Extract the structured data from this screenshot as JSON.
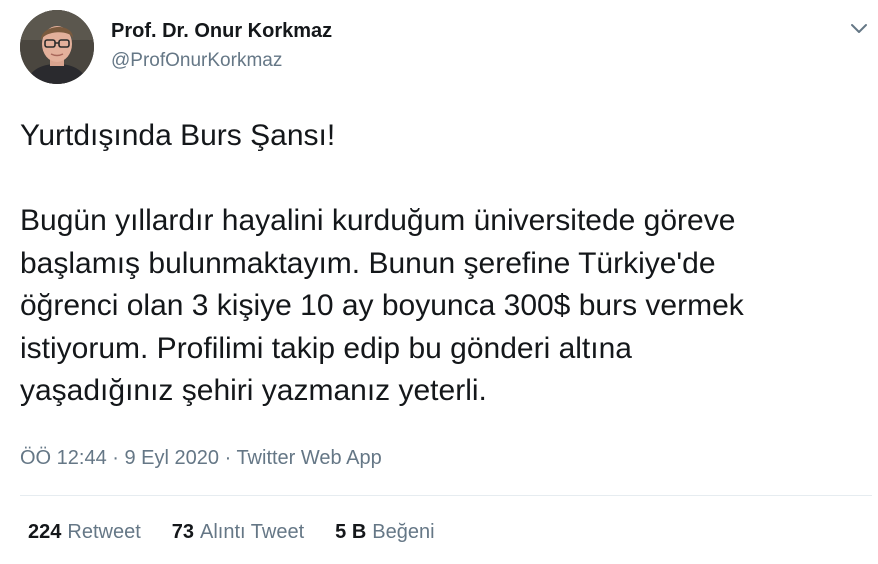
{
  "author": {
    "name": "Prof. Dr. Onur Korkmaz",
    "handle": "@ProfOnurKorkmaz"
  },
  "tweet": {
    "lines": [
      "Yurtdışında Burs Şansı!",
      "",
      "Bugün yıllardır hayalini kurduğum üniversitede göreve",
      "başlamış bulunmaktayım. Bunun şerefine Türkiye'de",
      "öğrenci olan 3 kişiye 10 ay boyunca 300$ burs vermek",
      "istiyorum. Profilimi takip edip bu gönderi altına",
      "yaşadığınız şehiri yazmanız yeterli."
    ]
  },
  "meta": {
    "time": "ÖÖ 12:44",
    "separator": " · ",
    "date": "9 Eyl 2020",
    "source": "Twitter Web App"
  },
  "stats": {
    "retweets": {
      "count": "224",
      "label": "Retweet"
    },
    "quotes": {
      "count": "73",
      "label": "Alıntı Tweet"
    },
    "likes": {
      "count": "5 B",
      "label": "Beğeni"
    }
  },
  "icons": {
    "caret": "chevron-down-icon",
    "avatar": "profile-photo"
  },
  "colors": {
    "text": "#14171a",
    "secondary": "#657786",
    "divider": "#e6ecf0"
  }
}
